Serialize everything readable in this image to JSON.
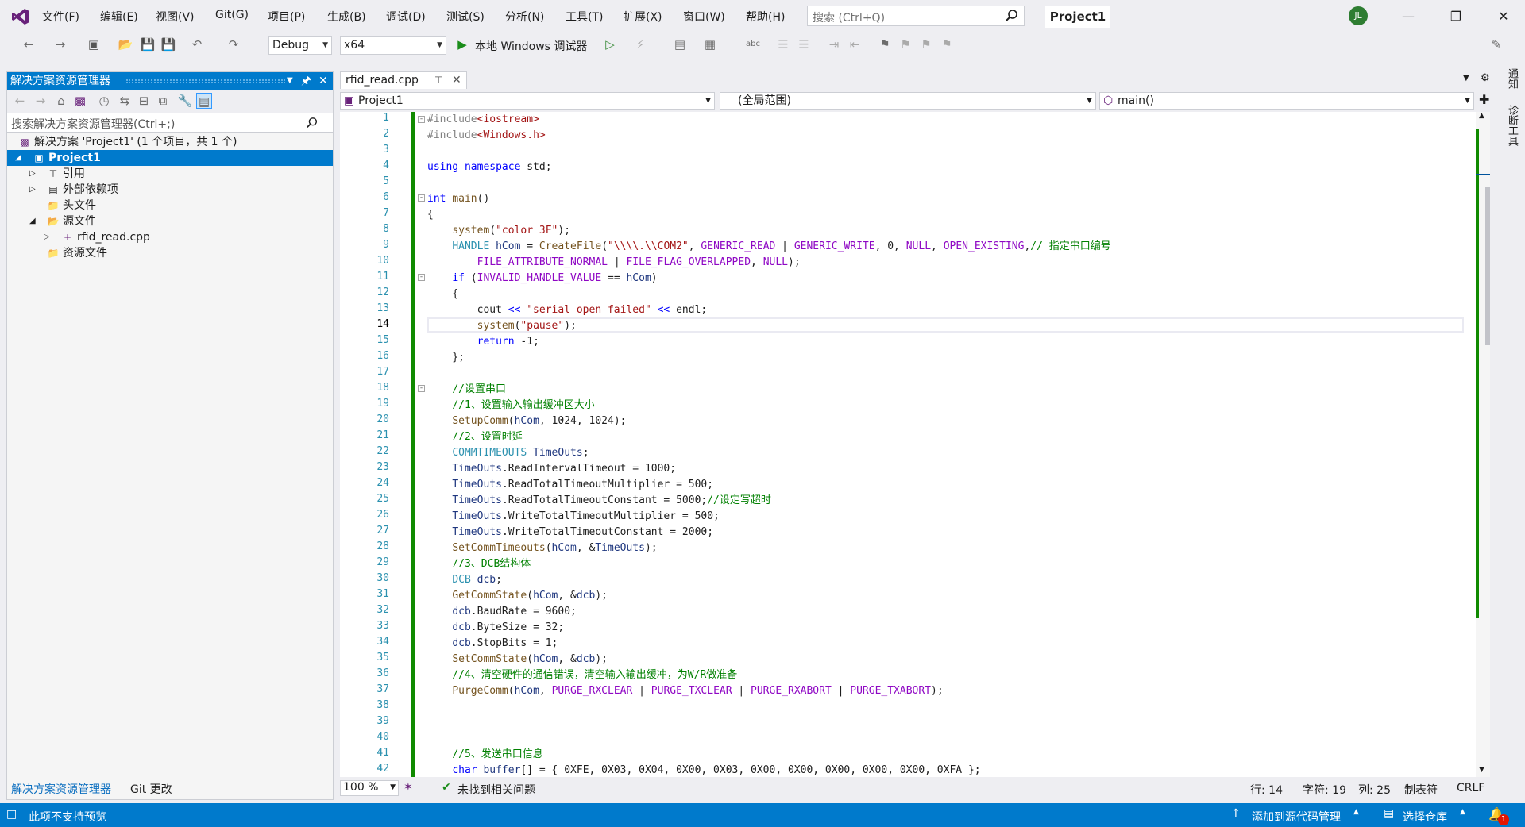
{
  "menu": [
    "文件(F)",
    "编辑(E)",
    "视图(V)",
    "Git(G)",
    "项目(P)",
    "生成(B)",
    "调试(D)",
    "测试(S)",
    "分析(N)",
    "工具(T)",
    "扩展(X)",
    "窗口(W)",
    "帮助(H)"
  ],
  "search": {
    "placeholder": "搜索 (Ctrl+Q)"
  },
  "project_name": "Project1",
  "avatar_initials": "JL",
  "toolbar": {
    "config": "Debug",
    "platform": "x64",
    "run_label": "本地 Windows 调试器"
  },
  "solution_explorer": {
    "title": "解决方案资源管理器",
    "search_placeholder": "搜索解决方案资源管理器(Ctrl+;)",
    "tree": [
      {
        "label": "解决方案 'Project1' (1 个项目，共 1 个)",
        "icon": "solution-icon"
      },
      {
        "label": "Project1",
        "icon": "project-icon",
        "selected": true
      },
      {
        "label": "引用",
        "icon": "references-icon"
      },
      {
        "label": "外部依赖项",
        "icon": "external-deps-icon"
      },
      {
        "label": "头文件",
        "icon": "folder-icon"
      },
      {
        "label": "源文件",
        "icon": "folder-icon"
      },
      {
        "label": "rfid_read.cpp",
        "icon": "cpp-file-icon"
      },
      {
        "label": "资源文件",
        "icon": "folder-icon"
      }
    ],
    "footer_tabs": [
      "解决方案资源管理器",
      "Git 更改"
    ]
  },
  "editor": {
    "tab_label": "rfid_read.cpp",
    "nav_project": "Project1",
    "nav_scope": "(全局范围)",
    "nav_member": "main()",
    "current_line": 14,
    "line_numbers": [
      "1",
      "2",
      "3",
      "4",
      "5",
      "6",
      "7",
      "8",
      "9",
      "10",
      "11",
      "12",
      "13",
      "14",
      "15",
      "16",
      "17",
      "18",
      "19",
      "20",
      "21",
      "22",
      "23",
      "24",
      "25",
      "26",
      "27",
      "28",
      "29",
      "30",
      "31",
      "32",
      "33",
      "34",
      "35",
      "36",
      "37",
      "38",
      "39",
      "40",
      "41",
      "42"
    ]
  },
  "status_strip": {
    "zoom": "100 %",
    "issues": "未找到相关问题",
    "line": "行: 14",
    "char": "字符: 19",
    "col": "列: 25",
    "tabs": "制表符",
    "eol": "CRLF"
  },
  "statusbar": {
    "left": "此项不支持预览",
    "source_control": "添加到源代码管理",
    "repo": "选择仓库",
    "notification_count": "1"
  },
  "right_rail": [
    "通知",
    "诊断工具"
  ],
  "colors": {
    "accent": "#007acc",
    "change_bar": "#108a00",
    "keyword": "#0000ff",
    "type": "#2b91af",
    "string": "#a31515",
    "comment": "#008000",
    "macro": "#8f08c4",
    "function": "#74531f"
  }
}
